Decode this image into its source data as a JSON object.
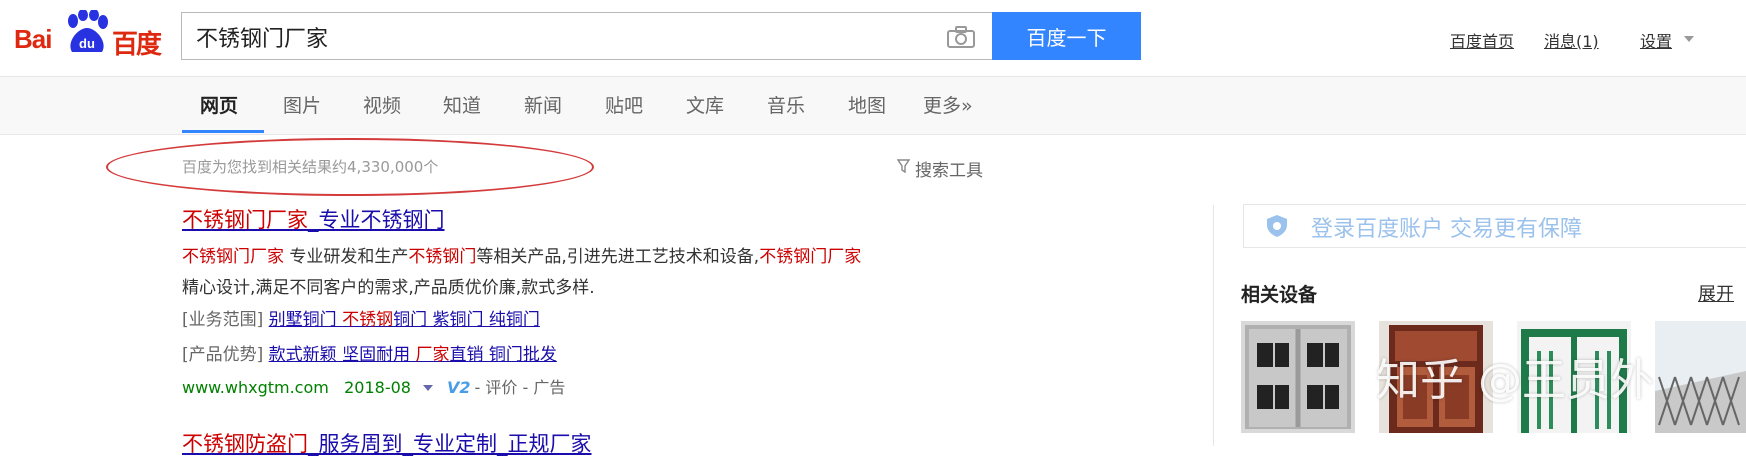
{
  "header": {
    "logo_text_left": "Bai",
    "logo_text_paw": "du",
    "logo_text_right": "百度",
    "search_value": "不锈钢门厂家",
    "search_button": "百度一下",
    "links": {
      "home": "百度首页",
      "messages": "消息(1)",
      "settings": "设置"
    }
  },
  "nav": {
    "tabs": [
      "网页",
      "图片",
      "视频",
      "知道",
      "新闻",
      "贴吧",
      "文库",
      "音乐",
      "地图",
      "更多»"
    ],
    "active": "网页"
  },
  "results_meta": {
    "count_text": "百度为您找到相关结果约4,330,000个",
    "tools": "搜索工具"
  },
  "results": [
    {
      "title_red": "不锈钢门厂家",
      "title_rest": "_专业不锈钢门",
      "desc_line1_a": "不锈钢门厂家",
      "desc_line1_b": " 专业研发和生产",
      "desc_line1_c": "不锈钢门",
      "desc_line1_d": "等相关产品,引进先进工艺技术和设备,",
      "desc_line1_e": "不锈钢门厂家",
      "desc_line2": "精心设计,满足不同客户的需求,产品质优价廉,款式多样.",
      "sitelink1_label": "[业务范围]",
      "sitelink1_a": "别墅铜门 ",
      "sitelink1_b": "不锈钢",
      "sitelink1_c": "铜门 紫铜门 纯铜门",
      "sitelink2_label": "[产品优势]",
      "sitelink2_a": "款式新颖 坚固耐用 ",
      "sitelink2_b": "厂家",
      "sitelink2_c": "直销 铜门批发",
      "url": "www.whxgtm.com",
      "date": "2018-08",
      "badge": "V2",
      "review": "- 评价",
      "ad": "- 广告"
    },
    {
      "title_red": "不锈钢防盗门",
      "title_rest": "_服务周到_专业定制_正规厂家"
    }
  ],
  "right_panel": {
    "login_text": "登录百度账户  交易更有保障",
    "related_title": "相关设备",
    "expand": "展开",
    "watermark": "知乎 @王员外"
  },
  "colors": {
    "brand_red": "#de2910",
    "brand_blue": "#2932e1",
    "button_blue": "#3385ff",
    "link": "#1a0dab",
    "highlight_red": "#c00",
    "url_green": "#008000",
    "annotation_red": "#d33a3a"
  }
}
